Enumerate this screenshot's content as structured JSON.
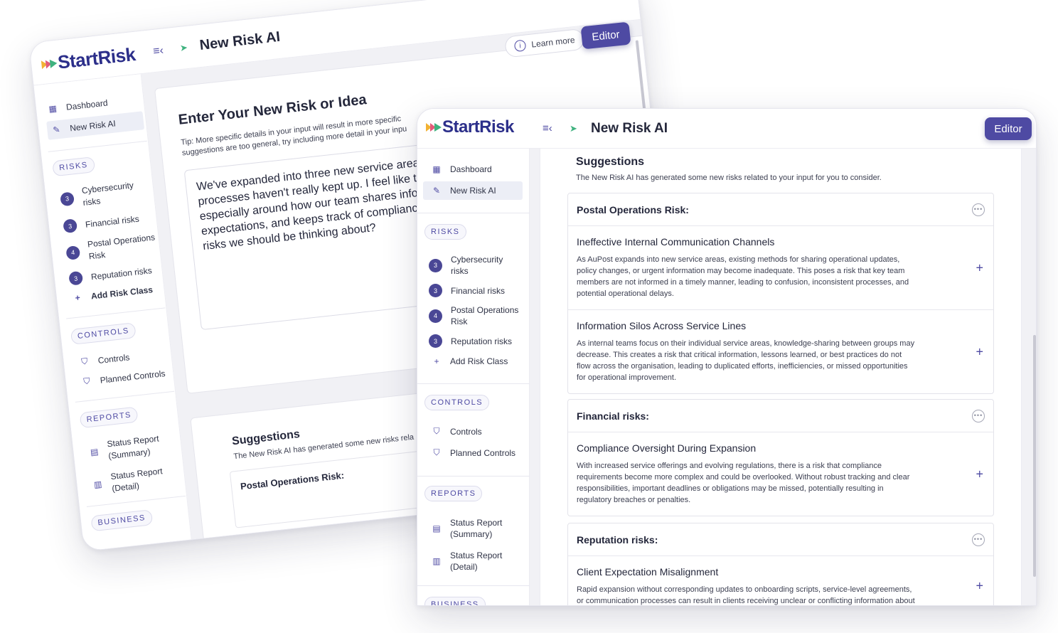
{
  "brand": {
    "name": "StartRisk"
  },
  "header": {
    "title": "New Risk AI",
    "editor_label": "Editor"
  },
  "sidebar": {
    "dashboard": "Dashboard",
    "new_risk_ai": "New Risk AI",
    "risks_label": "RISKS",
    "risks": [
      {
        "count": "3",
        "label_line1": "Cybersecurity",
        "label_line2": "risks"
      },
      {
        "count": "3",
        "label_line1": "Financial risks",
        "label_line2": ""
      },
      {
        "count": "4",
        "label_line1": "Postal Operations",
        "label_line2": "Risk"
      },
      {
        "count": "3",
        "label_line1": "Reputation risks",
        "label_line2": ""
      }
    ],
    "add_risk_class": "Add Risk Class",
    "controls_label": "CONTROLS",
    "controls": "Controls",
    "planned_controls": "Planned Controls",
    "reports_label": "REPORTS",
    "status_summary_line1": "Status Report",
    "status_summary_line2": "(Summary)",
    "status_detail_line1": "Status Report",
    "status_detail_line2": "(Detail)",
    "business_label": "BUSINESS"
  },
  "input_panel": {
    "learn_more": "Learn more",
    "heading": "Enter Your New Risk or Idea",
    "tip_line1": "Tip: More specific details in your input will result in more specific",
    "tip_line2": "suggestions are too general, try including more detail in your inpu",
    "text_lines": [
      "We've expanded into three new service area",
      "processes haven't really kept up. I feel like t",
      "especially around how our team shares info",
      "expectations, and keeps track of complianc",
      "risks we should be thinking about?"
    ]
  },
  "suggestions": {
    "title": "Suggestions",
    "subtitle": "The New Risk AI has generated some new risks related to your input for you to consider.",
    "back_subtitle": "The New Risk AI has generated some new risks rela",
    "groups": [
      {
        "title": "Postal Operations Risk:",
        "items": [
          {
            "title": "Ineffective Internal Communication Channels",
            "lines": [
              "As AuPost expands into new service areas, existing methods for sharing operational updates,",
              "policy changes, or urgent information may become inadequate. This poses a risk that key team",
              "members are not informed in a timely manner, leading to confusion, inconsistent processes, and",
              "potential operational delays."
            ]
          },
          {
            "title": "Information Silos Across Service Lines",
            "lines": [
              "As internal teams focus on their individual service areas, knowledge-sharing between groups may",
              "decrease. This creates a risk that critical information, lessons learned, or best practices do not",
              "flow across the organisation, leading to duplicated efforts, inefficiencies, or missed opportunities",
              "for operational improvement."
            ]
          }
        ]
      },
      {
        "title": "Financial risks:",
        "items": [
          {
            "title": "Compliance Oversight During Expansion",
            "lines": [
              "With increased service offerings and evolving regulations, there is a risk that compliance",
              "requirements become more complex and could be overlooked. Without robust tracking and clear",
              "responsibilities, important deadlines or obligations may be missed, potentially resulting in",
              "regulatory breaches or penalties."
            ]
          }
        ]
      },
      {
        "title": "Reputation risks:",
        "items": [
          {
            "title": "Client Expectation Misalignment",
            "lines": [
              "Rapid expansion without corresponding updates to onboarding scripts, service-level agreements,",
              "or communication processes can result in clients receiving unclear or conflicting information about"
            ]
          }
        ]
      }
    ]
  },
  "colors": {
    "accent": "#4e4aa3",
    "brand_dark": "#2c2f8a",
    "background": "#f1f1f5"
  },
  "icons": [
    "menu-collapse-icon",
    "sparkle-arrows-icon",
    "dashboard-icon",
    "pencil-icon",
    "plus-icon",
    "shield-check-icon",
    "shield-icon",
    "document-icon",
    "documents-icon",
    "info-icon",
    "close-icon",
    "more-icon"
  ]
}
